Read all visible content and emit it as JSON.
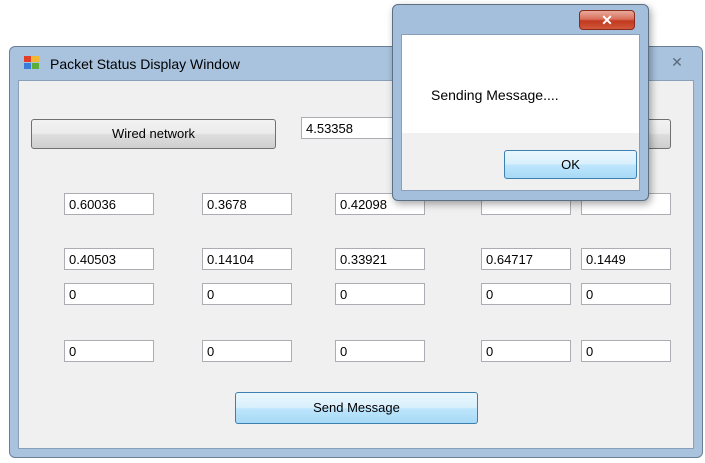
{
  "window": {
    "title": "Packet Status Display Window",
    "close_glyph": "✕",
    "icon": "app-window-icon"
  },
  "top_row": {
    "network_button_label": "Wired network",
    "value": "4.53358"
  },
  "grid": {
    "row1": [
      "0.60036",
      "0.3678",
      "0.42098"
    ],
    "row2": [
      "0.40503",
      "0.14104",
      "0.33921",
      "0.64717",
      "0.1449"
    ],
    "row3": [
      "0",
      "0",
      "0",
      "0",
      "0"
    ],
    "row4": [
      "0",
      "0",
      "0",
      "0",
      "0"
    ]
  },
  "send_button_label": "Send Message",
  "dialog": {
    "message": "Sending Message....",
    "ok_label": "OK",
    "close_glyph": "✕"
  },
  "colors": {
    "window_frame": "#a9c3df",
    "client_bg": "#f0f0f0",
    "dialog_close": "#c2391f",
    "focus_border": "#3c7fb1"
  }
}
